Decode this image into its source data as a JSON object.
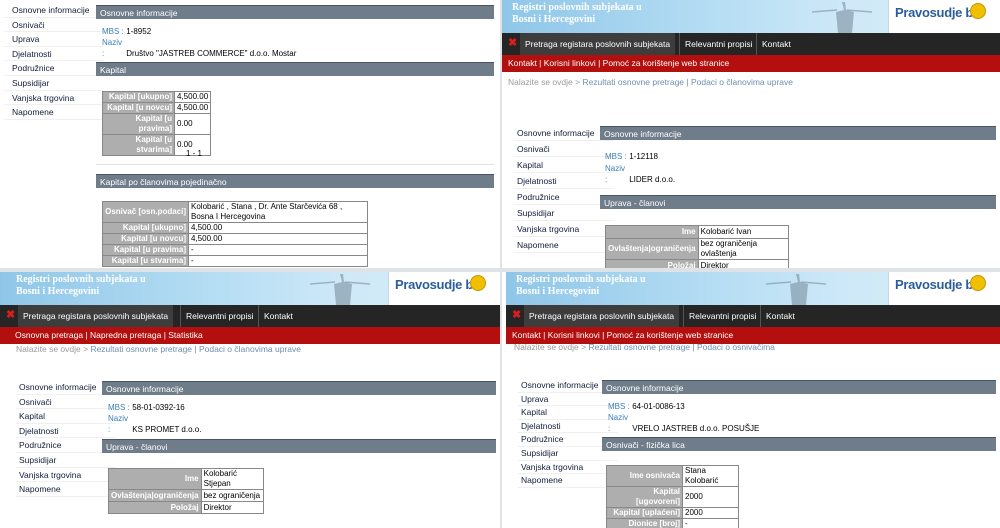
{
  "q1": {
    "sidebar": [
      "Osnovne informacije",
      "Osnivači",
      "Uprava",
      "Djelatnosti",
      "Podružnice",
      "Supsidijar",
      "Vanjska trgovina",
      "Napomene"
    ],
    "osnovne_header": "Osnovne informacije",
    "mbs_label": "MBS :",
    "mbs_value": "1-8952",
    "naziv_label": "Naziv :",
    "naziv_value": "Društvo \"JASTREB COMMERCE\" d.o.o. Mostar",
    "kapital_header": "Kapital",
    "kapital_rows": [
      {
        "label": "Kapital [ukupno]",
        "value": "4,500.00"
      },
      {
        "label": "Kapital [u novcu]",
        "value": "4,500.00"
      },
      {
        "label": "Kapital [u pravima]",
        "value": "0.00"
      },
      {
        "label": "Kapital [u stvarima]",
        "value": "0.00"
      }
    ],
    "pager": "1 - 1",
    "clanovi_header": "Kapital po članovima pojedinačno",
    "osnivac_label": "Osnivač [osn.podaci]",
    "osnivac_value": "Kolobarić , Stana , Dr. Ante Starčevića 68 , Bosna I Hercegovina",
    "clan_rows": [
      {
        "label": "Kapital [ukupno]",
        "value": "4,500.00"
      },
      {
        "label": "Kapital [u novcu]",
        "value": "4,500.00"
      },
      {
        "label": "Kapital [u pravima]",
        "value": "-"
      },
      {
        "label": "Kapital [u stvarima]",
        "value": "-"
      }
    ]
  },
  "q2": {
    "banner_title": "Registri poslovnih subjekata u Bosni i Hercegovini",
    "logo": "Pravosudje ba",
    "topnav": [
      "Pretraga registara poslovnih subjekata",
      "Relevantni propisi",
      "Kontakt"
    ],
    "subnav": "Kontakt | Korisni linkovi | Pomoć za korištenje web stranice",
    "crumb_prefix": "Nalazite se ovdje >",
    "crumb_path": "Rezultati osnovne pretrage | Podaci o članovima uprave",
    "sidebar": [
      "Osnovne informacije",
      "Osnivači",
      "Kapital",
      "Djelatnosti",
      "Podružnice",
      "Supsidijar",
      "Vanjska trgovina",
      "Napomene"
    ],
    "osnovne_header": "Osnovne informacije",
    "mbs_label": "MBS :",
    "mbs_value": "1-12118",
    "naziv_label": "Naziv :",
    "naziv_value": "LIDER d.o.o.",
    "uprava_header": "Uprava - članovi",
    "rows": [
      {
        "label": "Ime",
        "value": "Kolobarić Ivan"
      },
      {
        "label": "Ovlaštenja|ograničenja",
        "value": "bez ograničenja ovlaštenja"
      },
      {
        "label": "Položaj",
        "value": "Direktor"
      }
    ]
  },
  "q3": {
    "banner_title": "Registri poslovnih subjekata u Bosni i Hercegovini",
    "logo": "Pravosudje ba",
    "topnav": [
      "Pretraga registara poslovnih subjekata",
      "Relevantni propisi",
      "Kontakt"
    ],
    "subnav": "Osnovna pretraga | Napredna pretraga | Statistika",
    "crumb_prefix": "Nalazite se ovdje >",
    "crumb_path": "Rezultati osnovne pretrage | Podaci o članovima uprave",
    "sidebar": [
      "Osnovne informacije",
      "Osnivači",
      "Kapital",
      "Djelatnosti",
      "Podružnice",
      "Supsidijar",
      "Vanjska trgovina",
      "Napomene"
    ],
    "osnovne_header": "Osnovne informacije",
    "mbs_label": "MBS :",
    "mbs_value": "58-01-0392-16",
    "naziv_label": "Naziv :",
    "naziv_value": "KS PROMET d.o.o.",
    "uprava_header": "Uprava - članovi",
    "rows": [
      {
        "label": "Ime",
        "value": "Kolobarić Stjepan"
      },
      {
        "label": "Ovlaštenja|ograničenja",
        "value": "bez ograničenja"
      },
      {
        "label": "Položaj",
        "value": "Direktor"
      }
    ]
  },
  "q4": {
    "banner_title": "Registri poslovnih subjekata u Bosni i Hercegovini",
    "logo": "Pravosudje ba",
    "topnav": [
      "Pretraga registara poslovnih subjekata",
      "Relevantni propisi",
      "Kontakt"
    ],
    "subnav": "Kontakt | Korisni linkovi | Pomoć za korištenje web stranice",
    "crumb_prefix": "Nalazite se ovdje >",
    "crumb_path": "Rezultati osnovne pretrage | Podaci o osnivačima",
    "sidebar": [
      "Osnovne informacije",
      "Uprava",
      "Kapital",
      "Djelatnosti",
      "Podružnice",
      "Supsidijar",
      "Vanjska trgovina",
      "Napomene"
    ],
    "osnovne_header": "Osnovne informacije",
    "mbs_label": "MBS :",
    "mbs_value": "64-01-0086-13",
    "naziv_label": "Naziv :",
    "naziv_value": "VRELO JASTREB d.o.o. POSUŠJE",
    "osnivaci_header": "Osnivači - fizička lica",
    "rows": [
      {
        "label": "Ime osnivača",
        "value": "Stana Kolobarić"
      },
      {
        "label": "Kapital [ugovoreni]",
        "value": "2000"
      },
      {
        "label": "Kapital [uplaćeni]",
        "value": "2000"
      },
      {
        "label": "Dionice [broj]",
        "value": "-"
      }
    ]
  },
  "colors": {
    "nav_bg": "#252525",
    "subnav_red": "#b30f0f",
    "panel_header": "#6f7d8a",
    "label_blue": "#3a7fb9",
    "table_label_bg": "#aeaeae"
  }
}
